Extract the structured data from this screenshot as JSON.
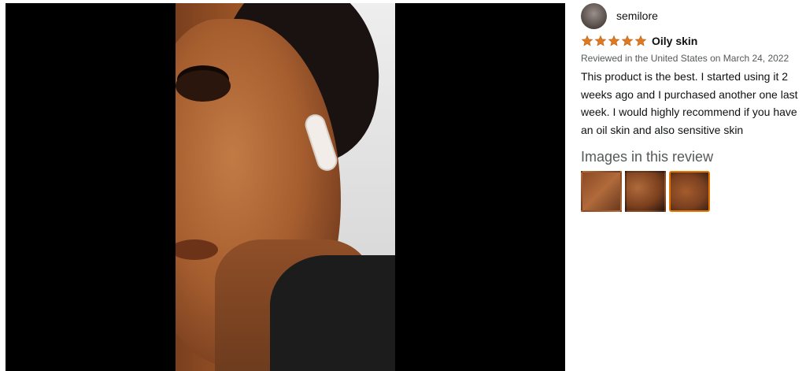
{
  "reviewer": {
    "name": "semilore",
    "avatar_icon": "avatar-photo"
  },
  "review": {
    "rating": 5,
    "rating_max": 5,
    "title": "Oily skin",
    "date": "Reviewed in the United States on March 24, 2022",
    "body": "This product is the best. I started using it 2 weeks ago and I purchased another one last week. I would highly recommend if you have an oil skin and also sensitive skin"
  },
  "images_section": {
    "heading": "Images in this review",
    "selected_index": 2,
    "thumbnail_count": 3
  },
  "colors": {
    "star": "#de7921",
    "selected_border": "#e77600",
    "viewer_bg": "#000000"
  }
}
